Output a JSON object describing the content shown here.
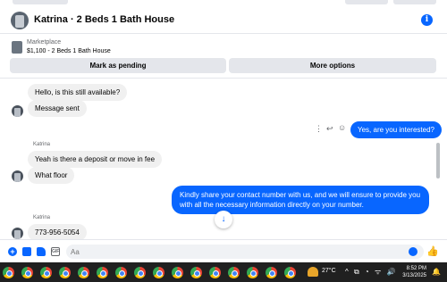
{
  "header": {
    "title": "Katrina · 2 Beds 1 Bath House",
    "info_symbol": "i"
  },
  "marketplace": {
    "label": "Marketplace",
    "listing": "$1,100 - 2 Beds 1 Bath House",
    "mark_pending_label": "Mark as pending",
    "more_options_label": "More options"
  },
  "messages": [
    {
      "from": "buyer",
      "text": "Hello, is this still available?"
    },
    {
      "from": "buyer",
      "text": "Message sent"
    },
    {
      "from": "me",
      "text": "Yes, are you interested?"
    },
    {
      "from": "Katrina",
      "sender_label": "Katrina",
      "text": "Yeah is there a deposit or move in fee"
    },
    {
      "from": "Katrina",
      "text": "What floor"
    },
    {
      "from": "me",
      "text": "Kindly share your contact number with us, and we will ensure to provide you with all the necessary information directly on your number."
    },
    {
      "from": "Katrina",
      "sender_label": "Katrina",
      "text": "773-956-5054"
    }
  ],
  "message_actions": {
    "more": "⋮",
    "reply": "↩",
    "react": "☺"
  },
  "composer": {
    "placeholder": "Aa",
    "gif_label": "GIF",
    "like_glyph": "👍"
  },
  "taskbar": {
    "weather_temp": "27°C",
    "time": "8:52 PM",
    "date": "3/13/2025",
    "tray_icons": "^ ⧉ ◔ ᯤ 🔊"
  }
}
